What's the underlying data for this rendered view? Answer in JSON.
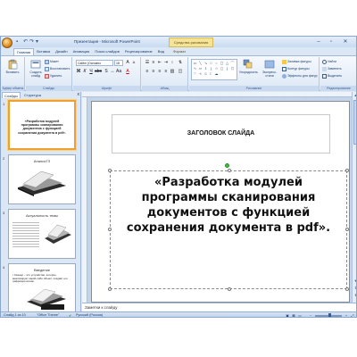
{
  "window": {
    "title": "Презентация - Microsoft PowerPoint",
    "context_tab_title": "Средства рисования",
    "qat": [
      "save-icon",
      "undo-icon",
      "redo-icon",
      "dropdown-icon"
    ],
    "controls": [
      "–",
      "▫",
      "✕"
    ]
  },
  "tabs": [
    {
      "label": "Главная",
      "active": true
    },
    {
      "label": "Вставка"
    },
    {
      "label": "Дизайн"
    },
    {
      "label": "Анимация"
    },
    {
      "label": "Показ слайдов"
    },
    {
      "label": "Рецензирование"
    },
    {
      "label": "Вид"
    },
    {
      "label": "Формат",
      "context": true
    }
  ],
  "ribbon": {
    "clipboard": {
      "paste": "Вставить",
      "label": "Буфер обмена"
    },
    "slides": {
      "new_slide": "Создать слайд",
      "layout": "Макет",
      "reset": "Восстановить",
      "delete": "Удалить",
      "label": "Слайды"
    },
    "font": {
      "name": "Calibri (Основно",
      "size": "18",
      "label": "Шрифт"
    },
    "paragraph": {
      "label": "Абзац"
    },
    "drawing": {
      "arrange": "Упорядочить",
      "quick_styles": "Экспресс-стили",
      "fill": "Заливка фигуры",
      "outline": "Контур фигуры",
      "effects": "Эффекты для фигур",
      "label": "Рисование"
    },
    "editing": {
      "find": "Найти",
      "replace": "Заменить",
      "select": "Выделить",
      "label": "Редактирование"
    }
  },
  "pane": {
    "tab_slides": "Слайды",
    "tab_outline": "Структура",
    "close": "x",
    "thumbnails": [
      {
        "num": "1",
        "text": "«Разработка модулей программы сканирования документов с функцией сохранения документа в pdf».",
        "selected": true
      },
      {
        "num": "2",
        "title": "АнализТЗ"
      },
      {
        "num": "3",
        "title": "Актуальность темы"
      },
      {
        "num": "4",
        "title": "Введение",
        "text": "• Сканер – это устройство, которое, анализирует какой-либо объект, создаёт его цифровую копию."
      }
    ]
  },
  "slide": {
    "title": "ЗАГОЛОВОК СЛАЙДА",
    "content": "«Разработка модулей  программы сканирования документов с функцией сохранения документа в pdf»."
  },
  "notes": {
    "placeholder": "Заметки к слайду"
  },
  "status": {
    "slide_counter": "Слайд 1 из 10",
    "theme": "\"Office Theme\"",
    "language": "Русский (Россия)",
    "zoom_level": 0.55
  },
  "colors": {
    "selection": "#f0a030",
    "rotation_handle": "#3fbf3f",
    "ribbon_bg": "#dbe7f5"
  }
}
